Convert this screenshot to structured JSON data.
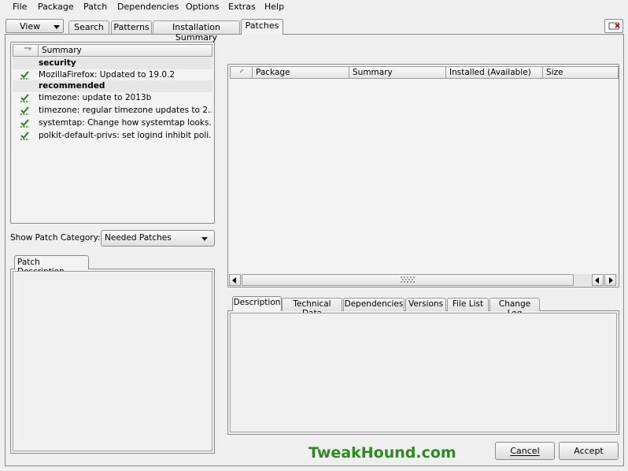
{
  "menubar": {
    "items": [
      "File",
      "Package",
      "Patch",
      "Dependencies",
      "Options",
      "Extras",
      "Help"
    ]
  },
  "toolbar": {
    "view_label": "View",
    "tabs": [
      "Search",
      "Patterns",
      "Installation Summary",
      "Patches"
    ],
    "active_tab": "Patches"
  },
  "patch_list": {
    "summary_header": "Summary",
    "rows": [
      {
        "type": "category",
        "label": "security"
      },
      {
        "type": "patch",
        "label": "MozillaFirefox: Updated to 19.0.2"
      },
      {
        "type": "category",
        "label": "recommended"
      },
      {
        "type": "patch",
        "label": "timezone: update to 2013b"
      },
      {
        "type": "patch",
        "label": "timezone: regular timezone updates to 2..."
      },
      {
        "type": "patch",
        "label": "systemtap: Change how systemtap looks..."
      },
      {
        "type": "patch",
        "label": "polkit-default-privs: set logind inhibit poli..."
      }
    ]
  },
  "category_filter": {
    "label": "Show Patch Category:",
    "selected": "Needed Patches"
  },
  "patch_description": {
    "tab_label": "Patch Description"
  },
  "package_table": {
    "columns": [
      "Package",
      "Summary",
      "Installed (Available)",
      "Size"
    ]
  },
  "details_tabs": [
    "Description",
    "Technical Data",
    "Dependencies",
    "Versions",
    "File List",
    "Change Log"
  ],
  "details_active": "Description",
  "watermark": "TweakHound.com",
  "buttons": {
    "cancel": "Cancel",
    "accept": "Accept"
  },
  "colors": {
    "accent_green": "#2e8b1f",
    "background": "#efefef"
  }
}
